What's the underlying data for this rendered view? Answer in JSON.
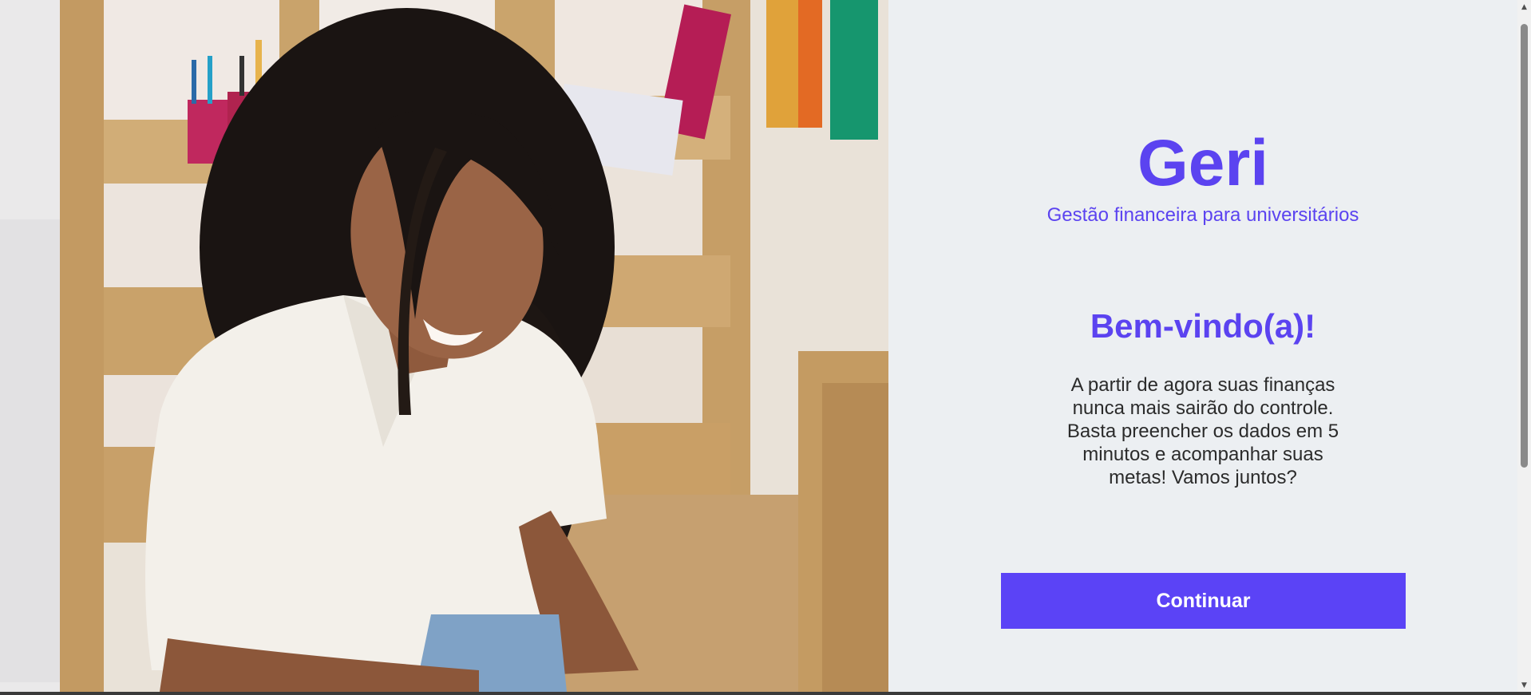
{
  "hero": {
    "icon": "woman-smiling-photo",
    "colors": {
      "wood": "#c9a878",
      "shelf_dark": "#a8834f",
      "hair": "#1a1412",
      "skin": "#9a6446",
      "shirt": "#f3f0ea"
    }
  },
  "panel": {
    "brand": "Geri",
    "tagline": "Gestão financeira para universitários",
    "welcome_title": "Bem-vindo(a)!",
    "message": "A partir de agora suas finanças nunca mais sairão do controle. Basta preencher os dados em 5 minutos e acompanhar suas metas! Vamos juntos?",
    "continue_label": "Continuar"
  },
  "scrollbar": {
    "up_icon": "arrow-up-icon",
    "down_icon": "arrow-down-icon",
    "up_glyph": "▲",
    "down_glyph": "▼"
  },
  "colors": {
    "accent": "#5b43f0",
    "button": "#5b43f6",
    "panel_bg": "#eceff2",
    "text": "#2b2b2b"
  }
}
